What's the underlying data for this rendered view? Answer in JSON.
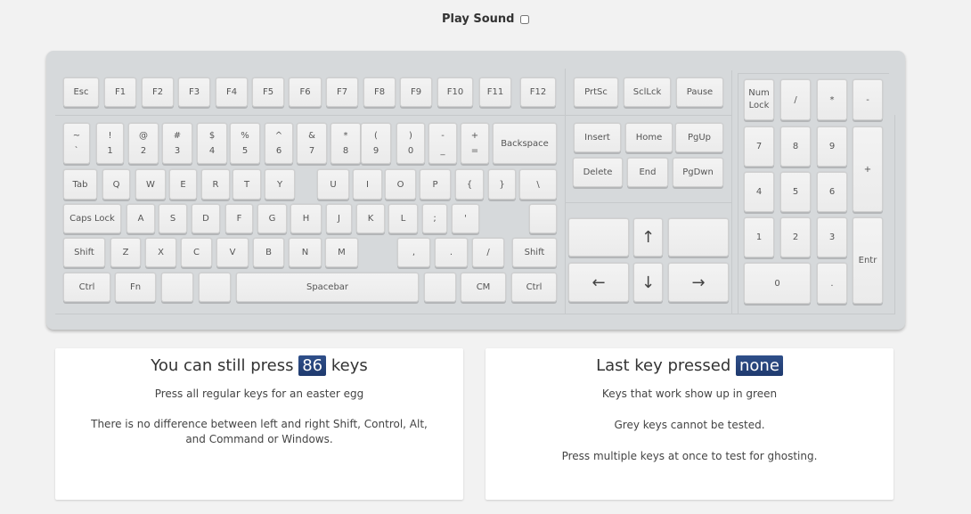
{
  "header": {
    "play_sound_label": "Play Sound",
    "play_sound_checked": false
  },
  "keyboard": {
    "function_row": [
      "Esc",
      "F1",
      "F2",
      "F3",
      "F4",
      "F5",
      "F6",
      "F7",
      "F8",
      "F9",
      "F10",
      "F11",
      "F12"
    ],
    "number_row": [
      {
        "top": "~",
        "bottom": "`"
      },
      {
        "top": "!",
        "bottom": "1"
      },
      {
        "top": "@",
        "bottom": "2"
      },
      {
        "top": "#",
        "bottom": "3"
      },
      {
        "top": "$",
        "bottom": "4"
      },
      {
        "top": "%",
        "bottom": "5"
      },
      {
        "top": "^",
        "bottom": "6"
      },
      {
        "top": "&",
        "bottom": "7"
      },
      {
        "top": "*",
        "bottom": "8"
      },
      {
        "top": "(",
        "bottom": "9"
      },
      {
        "top": ")",
        "bottom": "0"
      },
      {
        "top": "-",
        "bottom": "_"
      },
      {
        "top": "+",
        "bottom": "="
      },
      {
        "top": "Backspace",
        "bottom": ""
      }
    ],
    "qwerty_row": [
      "Tab",
      "Q",
      "W",
      "E",
      "R",
      "T",
      "Y",
      "U",
      "I",
      "O",
      "P",
      "{",
      "}",
      "\\"
    ],
    "home_row": [
      "Caps Lock",
      "A",
      "S",
      "D",
      "F",
      "G",
      "H",
      "J",
      "K",
      "L",
      ";",
      "'",
      ""
    ],
    "shift_row": [
      "Shift",
      "Z",
      "X",
      "C",
      "V",
      "B",
      "N",
      "M",
      ",",
      ".",
      "/",
      "Shift"
    ],
    "bottom_row": [
      "Ctrl",
      "Fn",
      "",
      "",
      "Spacebar",
      "",
      "CM",
      "Ctrl"
    ],
    "system_keys": [
      "PrtSc",
      "SclLck",
      "Pause"
    ],
    "nav_keys": [
      "Insert",
      "Home",
      "PgUp",
      "Delete",
      "End",
      "PgDwn"
    ],
    "arrow_keys": [
      "",
      "↑",
      "",
      "←",
      "↓",
      "→"
    ],
    "numpad": [
      "Num Lock",
      "/",
      "*",
      "-",
      "7",
      "8",
      "9",
      "+",
      "4",
      "5",
      "6",
      "1",
      "2",
      "3",
      "Entr",
      "0",
      "."
    ]
  },
  "left_panel": {
    "title_prefix": "You can still press",
    "remaining_count": "86",
    "title_suffix": "keys",
    "line1": "Press all regular keys for an easter egg",
    "line2": "There is no difference between left and right Shift, Control, Alt, and Command or Windows."
  },
  "right_panel": {
    "title_prefix": "Last key pressed",
    "last_key": "none",
    "line1": "Keys that work show up in green",
    "line2": "Grey keys cannot be tested.",
    "line3": "Press multiple keys at once to test for ghosting."
  }
}
